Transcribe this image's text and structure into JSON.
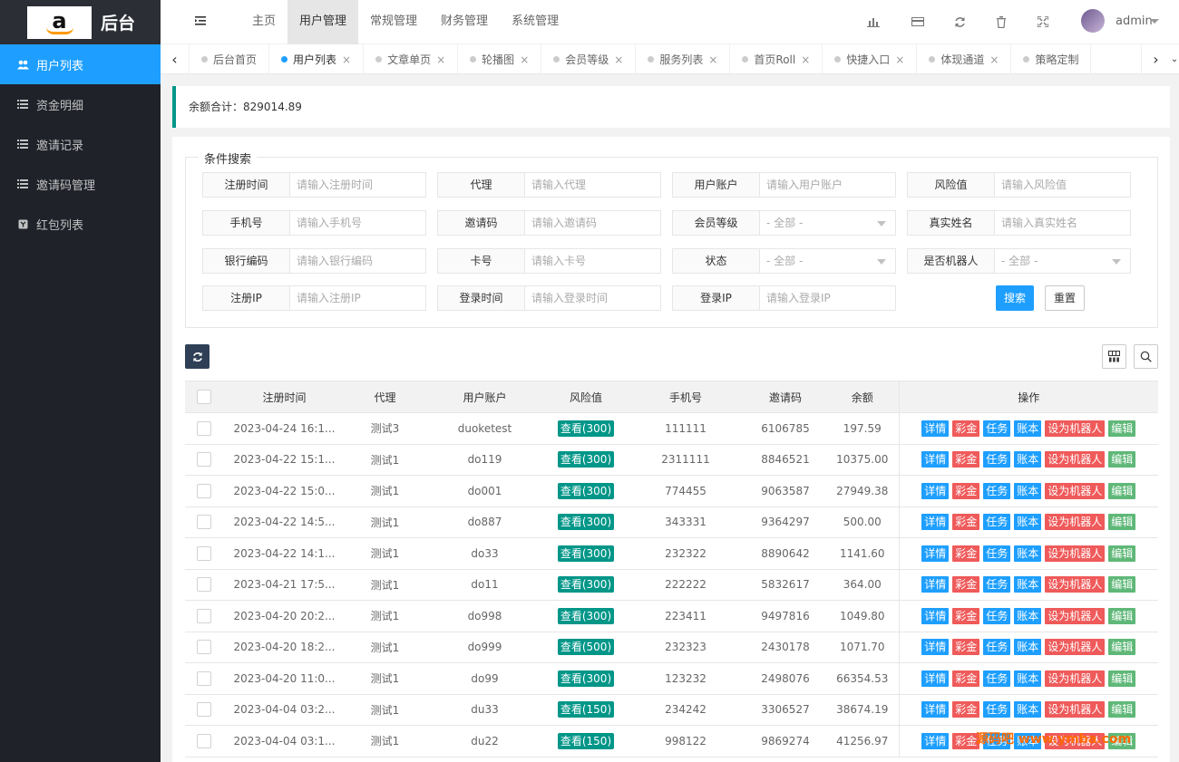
{
  "brand": {
    "logo_letter": "a",
    "title": "后台"
  },
  "sidebar": {
    "items": [
      {
        "label": "用户列表",
        "icon": "users-icon",
        "active": true
      },
      {
        "label": "资金明细",
        "icon": "list-icon",
        "active": false
      },
      {
        "label": "邀请记录",
        "icon": "list-icon",
        "active": false
      },
      {
        "label": "邀请码管理",
        "icon": "list-icon",
        "active": false
      },
      {
        "label": "红包列表",
        "icon": "redpacket-icon",
        "active": false
      }
    ]
  },
  "header": {
    "nav": [
      "主页",
      "用户管理",
      "常规管理",
      "财务管理",
      "系统管理"
    ],
    "active_nav": "用户管理",
    "username": "admin"
  },
  "tabs": [
    {
      "label": "后台首页",
      "closable": false,
      "active": false
    },
    {
      "label": "用户列表",
      "closable": true,
      "active": true
    },
    {
      "label": "文章单页",
      "closable": true,
      "active": false
    },
    {
      "label": "轮播图",
      "closable": true,
      "active": false
    },
    {
      "label": "会员等级",
      "closable": true,
      "active": false
    },
    {
      "label": "服务列表",
      "closable": true,
      "active": false
    },
    {
      "label": "首页Roll",
      "closable": true,
      "active": false
    },
    {
      "label": "快捷入口",
      "closable": true,
      "active": false
    },
    {
      "label": "体现通道",
      "closable": true,
      "active": false
    },
    {
      "label": "策略定制",
      "closable": false,
      "active": false
    }
  ],
  "summary": {
    "label": "余额合计：",
    "value": "829014.89"
  },
  "search": {
    "legend": "条件搜索",
    "fields": [
      {
        "label": "注册时间",
        "placeholder": "请输入注册时间",
        "type": "input"
      },
      {
        "label": "代理",
        "placeholder": "请输入代理",
        "type": "input"
      },
      {
        "label": "用户账户",
        "placeholder": "请输入用户账户",
        "type": "input"
      },
      {
        "label": "风险值",
        "placeholder": "请输入风险值",
        "type": "input"
      },
      {
        "label": "手机号",
        "placeholder": "请输入手机号",
        "type": "input"
      },
      {
        "label": "邀请码",
        "placeholder": "请输入邀请码",
        "type": "input"
      },
      {
        "label": "会员等级",
        "placeholder": "- 全部 -",
        "type": "select"
      },
      {
        "label": "真实姓名",
        "placeholder": "请输入真实姓名",
        "type": "input"
      },
      {
        "label": "银行编码",
        "placeholder": "请输入银行编码",
        "type": "input"
      },
      {
        "label": "卡号",
        "placeholder": "请输入卡号",
        "type": "input"
      },
      {
        "label": "状态",
        "placeholder": "- 全部 -",
        "type": "select"
      },
      {
        "label": "是否机器人",
        "placeholder": "- 全部 -",
        "type": "select"
      },
      {
        "label": "注册IP",
        "placeholder": "请输入注册IP",
        "type": "input"
      },
      {
        "label": "登录时间",
        "placeholder": "请输入登录时间",
        "type": "input"
      },
      {
        "label": "登录IP",
        "placeholder": "请输入登录IP",
        "type": "input"
      }
    ],
    "search_label": "搜索",
    "reset_label": "重置"
  },
  "table": {
    "columns": [
      "注册时间",
      "代理",
      "用户账户",
      "风险值",
      "手机号",
      "邀请码",
      "余额",
      "操作"
    ],
    "actions": [
      {
        "label": "详情",
        "color": "#1e9fff"
      },
      {
        "label": "彩金",
        "color": "#ef5a5a"
      },
      {
        "label": "任务",
        "color": "#1e9fff"
      },
      {
        "label": "账本",
        "color": "#1e9fff"
      },
      {
        "label": "设为机器人",
        "color": "#ef5a5a"
      },
      {
        "label": "编辑",
        "color": "#5fb878"
      }
    ],
    "rows": [
      {
        "time": "2023-04-24 16:1...",
        "agent": "测试3",
        "account": "duoketest",
        "risk": "查看(300)",
        "phone": "111111",
        "invite": "6106785",
        "balance": "197.59"
      },
      {
        "time": "2023-04-22 15:1...",
        "agent": "测试1",
        "account": "do119",
        "risk": "查看(300)",
        "phone": "2311111",
        "invite": "8846521",
        "balance": "10375.00"
      },
      {
        "time": "2023-04-22 15:0...",
        "agent": "测试1",
        "account": "do001",
        "risk": "查看(300)",
        "phone": "774455",
        "invite": "9063587",
        "balance": "27949.38"
      },
      {
        "time": "2023-04-22 14:5...",
        "agent": "测试1",
        "account": "do887",
        "risk": "查看(300)",
        "phone": "343331",
        "invite": "9364297",
        "balance": "500.00"
      },
      {
        "time": "2023-04-22 14:1...",
        "agent": "测试1",
        "account": "do33",
        "risk": "查看(300)",
        "phone": "232322",
        "invite": "8890642",
        "balance": "1141.60"
      },
      {
        "time": "2023-04-21 17:5...",
        "agent": "测试1",
        "account": "do11",
        "risk": "查看(300)",
        "phone": "222222",
        "invite": "5832617",
        "balance": "364.00"
      },
      {
        "time": "2023-04-20 20:2...",
        "agent": "测试1",
        "account": "do998",
        "risk": "查看(300)",
        "phone": "223411",
        "invite": "9497816",
        "balance": "1049.80"
      },
      {
        "time": "2023-04-20 18:2...",
        "agent": "测试1",
        "account": "do999",
        "risk": "查看(500)",
        "phone": "232323",
        "invite": "2430178",
        "balance": "1071.70"
      },
      {
        "time": "2023-04-20 11:0...",
        "agent": "测试1",
        "account": "do99",
        "risk": "查看(300)",
        "phone": "123232",
        "invite": "2498076",
        "balance": "66354.53"
      },
      {
        "time": "2023-04-04 03:2...",
        "agent": "测试1",
        "account": "du33",
        "risk": "查看(150)",
        "phone": "234242",
        "invite": "3306527",
        "balance": "38674.19"
      },
      {
        "time": "2023-04-04 03:1...",
        "agent": "测试1",
        "account": "du22",
        "risk": "查看(150)",
        "phone": "998122",
        "invite": "9869274",
        "balance": "41256.97"
      }
    ]
  },
  "watermark": "源码吧 www.ymba.com"
}
